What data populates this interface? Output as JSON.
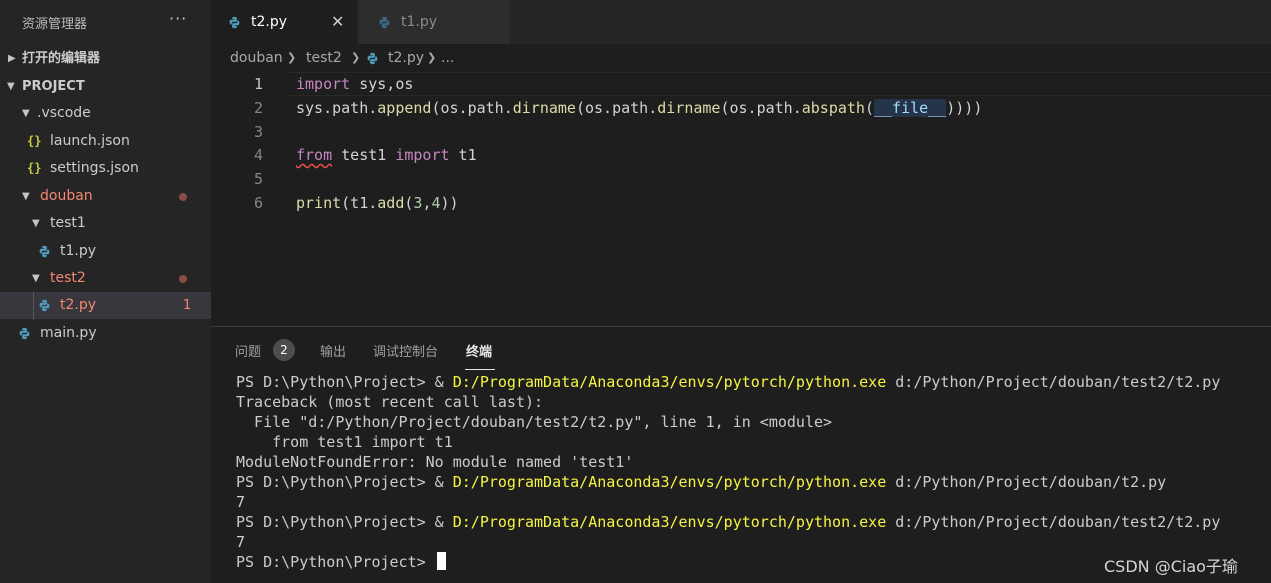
{
  "explorer": {
    "title": "资源管理器",
    "more": "···",
    "open_editors": "打开的编辑器",
    "project": "PROJECT",
    "tree": {
      "vscode": ".vscode",
      "launch": "launch.json",
      "settings": "settings.json",
      "douban": "douban",
      "test1": "test1",
      "t1": "t1.py",
      "test2": "test2",
      "t2": "t2.py",
      "t2_errors": "1",
      "main": "main.py"
    },
    "json_icon": "{}"
  },
  "tabs": [
    {
      "label": "t2.py",
      "close": "✕"
    },
    {
      "label": "t1.py"
    }
  ],
  "breadcrumb": {
    "root": "douban",
    "folder": "test2",
    "file": "t2.py",
    "ellipsis": "...",
    "sep": "〉"
  },
  "editor": {
    "line_numbers": [
      "1",
      "2",
      "3",
      "4",
      "5",
      "6"
    ],
    "line1": {
      "kw": "import",
      "rest": " sys,os"
    },
    "line2": {
      "a": "sys",
      "b": ".path.",
      "c": "append",
      "d": "(os.path.",
      "e": "dirname",
      "f": "(os.path.",
      "g": "dirname",
      "h": "(os.path.",
      "i": "abspath",
      "j": "(",
      "k": "__file__",
      "l": "))))"
    },
    "line4": {
      "kw1": "from",
      "mod": " test1 ",
      "kw2": "import",
      "rest": " t1"
    },
    "line6": {
      "fn": "print",
      "a": "(t1.",
      "b": "add",
      "c": "(",
      "n1": "3",
      "comma": ",",
      "n2": "4",
      "d": "))"
    }
  },
  "panel": {
    "tabs": [
      "问题",
      "输出",
      "调试控制台",
      "终端"
    ],
    "problems_count": "2",
    "terminal": [
      {
        "prompt": "PS D:\\Python\\Project> & ",
        "exe": "D:/ProgramData/Anaconda3/envs/pytorch/python.exe",
        "arg": " d:/Python/Project/douban/test2/t2.py"
      },
      {
        "text": "Traceback (most recent call last):"
      },
      {
        "text": "  File \"d:/Python/Project/douban/test2/t2.py\", line 1, in <module>"
      },
      {
        "text": "    from test1 import t1"
      },
      {
        "text": "ModuleNotFoundError: No module named 'test1'"
      },
      {
        "prompt": "PS D:\\Python\\Project> & ",
        "exe": "D:/ProgramData/Anaconda3/envs/pytorch/python.exe",
        "arg": " d:/Python/Project/douban/t2.py"
      },
      {
        "text": "7"
      },
      {
        "prompt": "PS D:\\Python\\Project> & ",
        "exe": "D:/ProgramData/Anaconda3/envs/pytorch/python.exe",
        "arg": " d:/Python/Project/douban/test2/t2.py"
      },
      {
        "text": "7"
      },
      {
        "prompt": "PS D:\\Python\\Project> "
      }
    ]
  },
  "watermark": "CSDN @Ciao子瑜",
  "colors": {
    "sidebar_bg": "#252526",
    "editor_bg": "#1e1e1e",
    "keyword": "#c586c0",
    "function": "#dcdcaa",
    "error_red": "#f48771",
    "terminal_exe": "#f5f543"
  },
  "icons": [
    "python-file-icon",
    "json-file-icon",
    "chevron-right-icon",
    "chevron-down-icon",
    "close-icon",
    "more-icon"
  ]
}
